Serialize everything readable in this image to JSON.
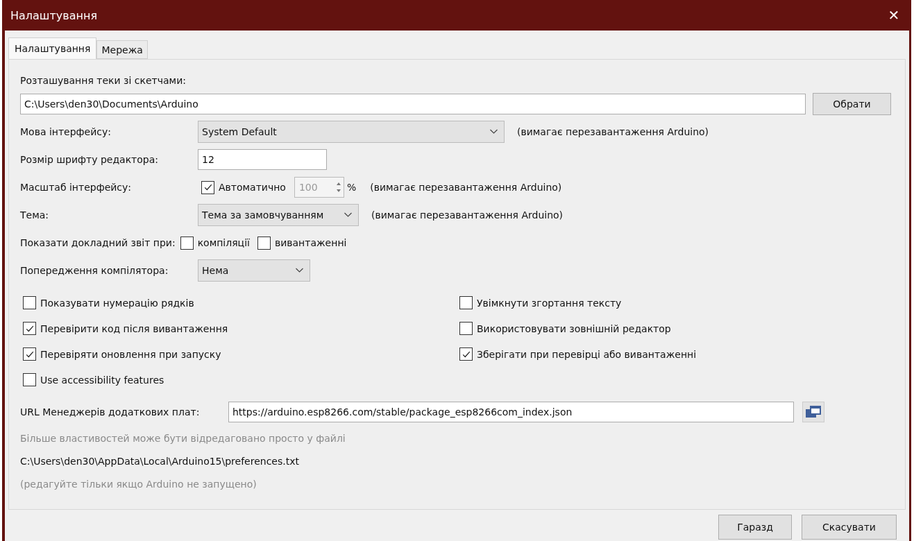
{
  "window": {
    "title": "Налаштування",
    "close": "✕"
  },
  "tabs": [
    {
      "label": "Налаштування",
      "selected": true
    },
    {
      "label": "Мережа",
      "selected": false
    }
  ],
  "sketchbook": {
    "label": "Розташування теки зі скетчами:",
    "value": "C:\\Users\\den30\\Documents\\Arduino",
    "button": "Обрати"
  },
  "language": {
    "label": "Мова інтерфейсу:",
    "value": "System Default",
    "note": "(вимагає перезавантаження Arduino)"
  },
  "font_size": {
    "label": "Розмір шрифту редактора:",
    "value": "12"
  },
  "scale": {
    "label": "Масштаб інтерфейсу:",
    "auto_label": "Автоматично",
    "auto_checked": true,
    "value": "100",
    "unit": "%",
    "note": "(вимагає перезавантаження Arduino)"
  },
  "theme": {
    "label": "Тема:",
    "value": "Тема за замовчуванням",
    "note": "(вимагає перезавантаження Arduino)"
  },
  "verbose": {
    "label": "Показати докладний звіт при:",
    "options": [
      {
        "label": "компіляції",
        "checked": false
      },
      {
        "label": "вивантаженні",
        "checked": false
      }
    ]
  },
  "warnings": {
    "label": "Попередження компілятора:",
    "value": "Нема"
  },
  "options_left": [
    {
      "label": "Показувати нумерацію рядків",
      "checked": false
    },
    {
      "label": "Перевірити код після вивантаження",
      "checked": true
    },
    {
      "label": "Перевіряти оновлення при запуску",
      "checked": true
    },
    {
      "label": "Use accessibility features",
      "checked": false
    }
  ],
  "options_right": [
    {
      "label": "Увімкнути згортання тексту",
      "checked": false
    },
    {
      "label": "Використовувати зовнішній редактор",
      "checked": false
    },
    {
      "label": "Зберігати при перевірці або вивантаженні",
      "checked": true
    }
  ],
  "boards_url": {
    "label": "URL Менеджерів додаткових плат:",
    "value": "https://arduino.esp8266.com/stable/package_esp8266com_index.json"
  },
  "footer_notes": [
    {
      "text": "Більше властивостей може бути відредаговано просто у файлі",
      "muted": true
    },
    {
      "text": "C:\\Users\\den30\\AppData\\Local\\Arduino15\\preferences.txt",
      "muted": false
    },
    {
      "text": "(редагуйте тільки якщо Arduino не запущено)",
      "muted": true
    }
  ],
  "buttons": [
    "Гаразд",
    "Скасувати"
  ]
}
